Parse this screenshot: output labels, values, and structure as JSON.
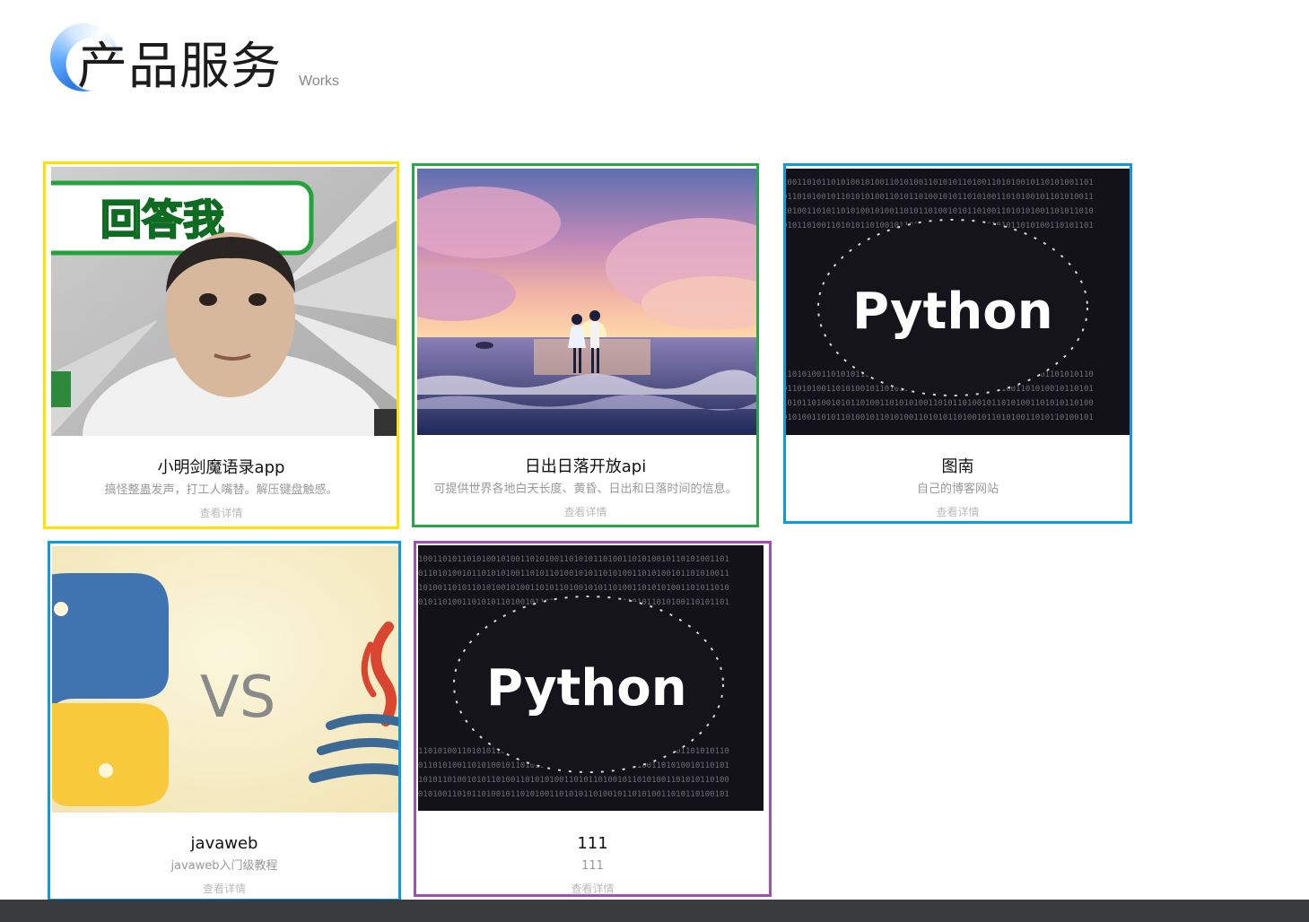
{
  "header": {
    "title": "产品服务",
    "subtitle": "Works"
  },
  "cards": [
    {
      "name": "小明剑魔语录app",
      "desc": "搞怪整蛊发声，打工人嘴替。解压键盘触感。",
      "more": "查看详情",
      "image_text": "回答我",
      "border_color": "#ffe300"
    },
    {
      "name": "日出日落开放api",
      "desc": "可提供世界各地白天长度、黄昏、日出和日落时间的信息。",
      "more": "查看详情",
      "border_color": "#27a844"
    },
    {
      "name": "图南",
      "desc": "自己的博客网站",
      "more": "查看详情",
      "image_text": "Python",
      "border_color": "#0d9bde"
    },
    {
      "name": "javaweb",
      "desc": "javaweb入门级教程",
      "more": "查看详情",
      "image_text": "VS",
      "border_color": "#0d9bde"
    },
    {
      "name": "111",
      "desc": "111",
      "more": "查看详情",
      "image_text": "Python",
      "border_color": "#a04db5"
    }
  ]
}
